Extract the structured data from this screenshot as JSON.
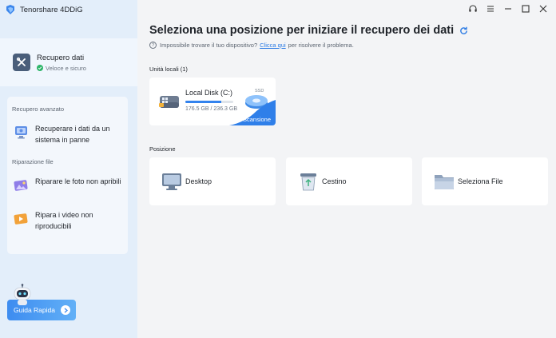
{
  "app": {
    "title": "Tenorshare 4DDiG"
  },
  "sidebar": {
    "recovery": {
      "label": "Recupero dati",
      "status": "Veloce e sicuro"
    },
    "advanced_section": "Recupero avanzato",
    "advanced_items": [
      {
        "label": "Recuperare i dati da un sistema in panne",
        "icon": "crashed-pc-icon"
      }
    ],
    "repair_section": "Riparazione file",
    "repair_items": [
      {
        "label": "Riparare le foto non apribili",
        "icon": "photo-repair-icon"
      },
      {
        "label": "Ripara i video non riproducibili",
        "icon": "video-repair-icon"
      }
    ],
    "guide_button": "Guida Rapida"
  },
  "main": {
    "title": "Seleziona una posizione per iniziare il recupero dei dati",
    "help": {
      "prefix": "Impossibile trovare il tuo dispositivo?",
      "link": "Clicca qui",
      "suffix": "per risolvere il problema."
    },
    "local_units_label": "Unità locali (1)",
    "disk": {
      "name": "Local Disk (C:)",
      "size": "176.5 GB / 236.3 GB",
      "used_fraction": 0.747,
      "badge": "SSD",
      "action": "Scansione"
    },
    "position_label": "Posizione",
    "locations": [
      {
        "label": "Desktop",
        "icon": "desktop-icon"
      },
      {
        "label": "Cestino",
        "icon": "recycle-bin-icon"
      },
      {
        "label": "Seleziona File",
        "icon": "folder-icon"
      }
    ]
  },
  "colors": {
    "accent": "#3383ee",
    "sidebar_bg": "#e3eefa",
    "main_bg": "#f3f4f6"
  }
}
